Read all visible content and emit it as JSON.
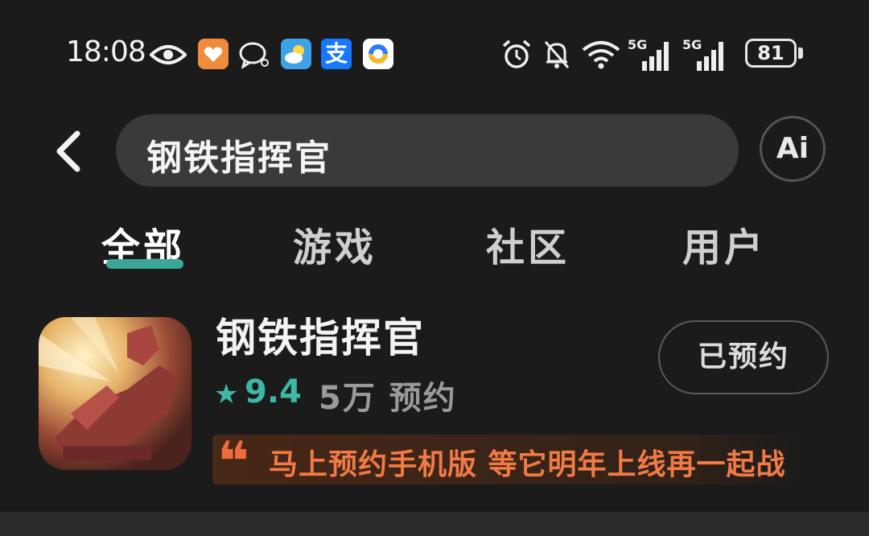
{
  "status_bar": {
    "time": "18:08",
    "alipay_glyph": "支",
    "net1": "5G",
    "net2": "5G",
    "battery": "81"
  },
  "search": {
    "query": "钢铁指挥官",
    "ai_label": "Ai"
  },
  "tabs": [
    {
      "label": "全部",
      "active": true
    },
    {
      "label": "游戏",
      "active": false
    },
    {
      "label": "社区",
      "active": false
    },
    {
      "label": "用户",
      "active": false
    }
  ],
  "result": {
    "title": "钢铁指挥官",
    "rating_icon": "★",
    "rating": "9.4",
    "reserve_count": "5万 预约",
    "button_label": "已预约",
    "quote_mark": "❝",
    "quote": "马上预约手机版 等它明年上线再一起战"
  },
  "colors": {
    "accent": "#3aa69a",
    "rating": "#3db8a7",
    "quote": "#f27a45",
    "background": "#1b1b1b"
  }
}
